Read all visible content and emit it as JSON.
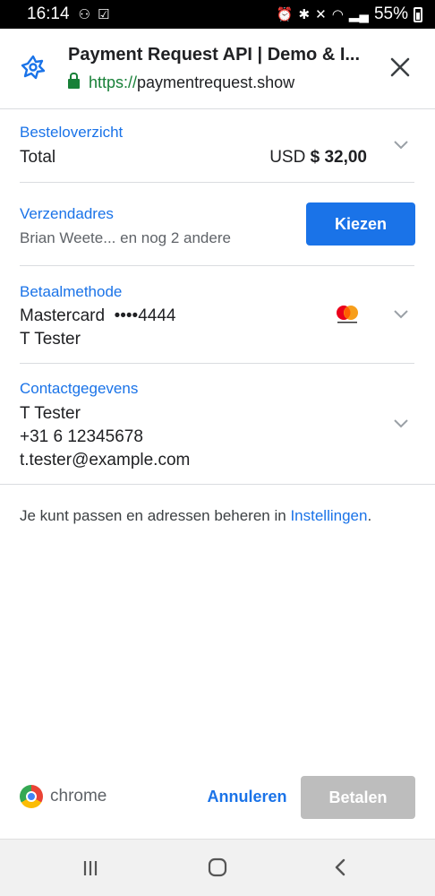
{
  "status_bar": {
    "time": "16:14",
    "battery_percent": "55%"
  },
  "header": {
    "title": "Payment Request API | Demo & I...",
    "url_scheme": "https://",
    "url_host": "paymentrequest.show"
  },
  "order_summary": {
    "label": "Besteloverzicht",
    "total_label": "Total",
    "currency": "USD",
    "amount": "$ 32,00"
  },
  "shipping": {
    "label": "Verzendadres",
    "summary": "Brian Weete... en nog 2 andere",
    "choose_button": "Kiezen"
  },
  "payment_method": {
    "label": "Betaalmethode",
    "card": "Mastercard  ••••4444",
    "holder": "T Tester",
    "card_icon": "mastercard-icon"
  },
  "contact": {
    "label": "Contactgegevens",
    "name": "T Tester",
    "phone": "+31 6 12345678",
    "email": "t.tester@example.com"
  },
  "info": {
    "text": "Je kunt passen en adressen beheren in ",
    "link": "Instellingen",
    "suffix": "."
  },
  "footer": {
    "brand": "chrome",
    "cancel_button": "Annuleren",
    "pay_button": "Betalen"
  },
  "colors": {
    "accent": "#1a73e8",
    "secure": "#188038",
    "disabled_button": "#bdbdbd"
  }
}
